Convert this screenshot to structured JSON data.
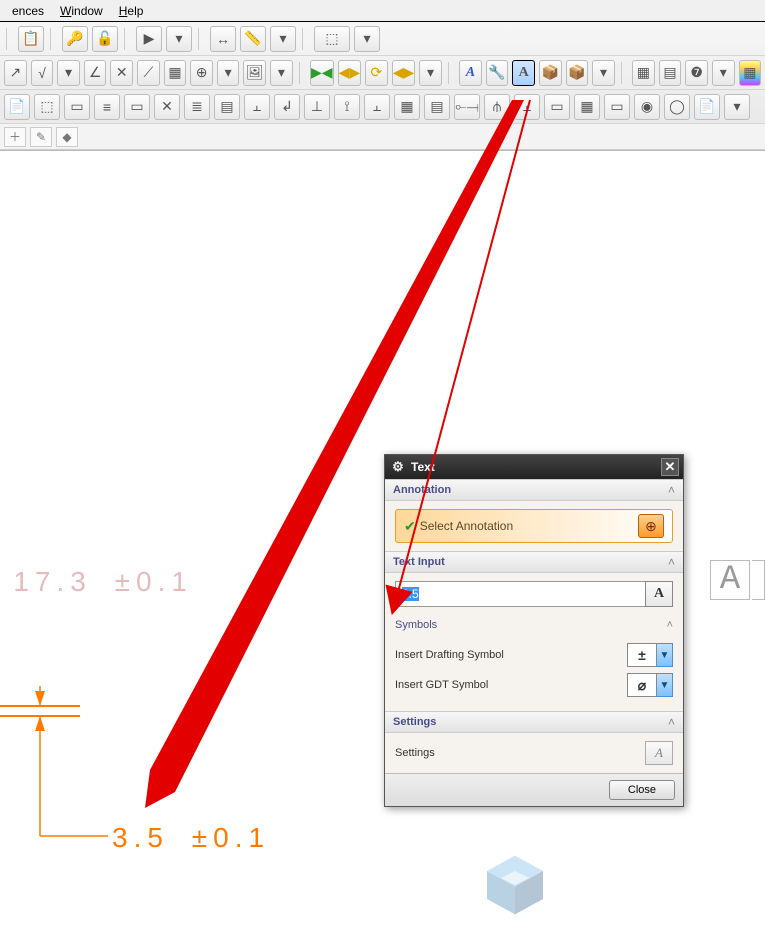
{
  "menubar": {
    "items": [
      "ences",
      "Window",
      "Help"
    ]
  },
  "canvas": {
    "dim1_value": "17.3",
    "dim1_tol": "±0.1",
    "dim2_value": "3.5",
    "dim2_tol": "±0.1"
  },
  "panel": {
    "title": "Text",
    "sections": {
      "annotation": {
        "header": "Annotation",
        "select_label": "Select Annotation"
      },
      "text_input": {
        "header": "Text Input",
        "value": "3.5",
        "symbols_header": "Symbols",
        "drafting_label": "Insert Drafting Symbol",
        "drafting_symbol": "±",
        "gdt_label": "Insert GDT Symbol",
        "gdt_symbol": "⌀"
      },
      "settings": {
        "header": "Settings",
        "label": "Settings"
      }
    },
    "close_button": "Close"
  },
  "ghost_letter": "A"
}
